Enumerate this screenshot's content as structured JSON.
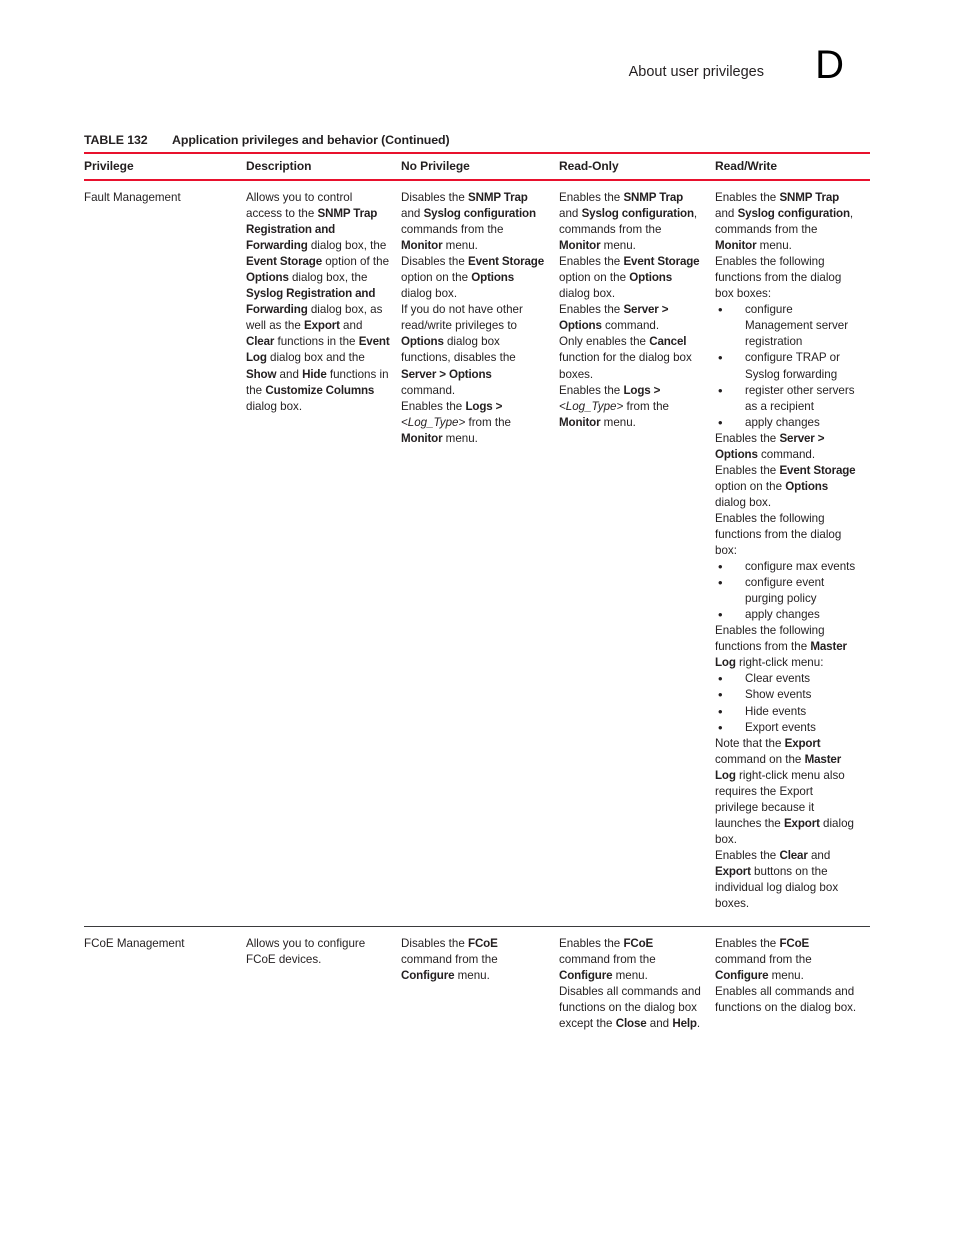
{
  "header": {
    "chapter_title": "About user privileges",
    "chapter_letter": "D"
  },
  "table": {
    "caption_number": "TABLE 132",
    "caption_text": "Application privileges and behavior (Continued)",
    "accent_color": "#e8112d",
    "rule_color": "#3a3a3c",
    "columns": [
      "Privilege",
      "Description",
      "No Privilege",
      "Read-Only",
      "Read/Write"
    ],
    "rows": [
      {
        "privilege": "Fault Management",
        "description_html": "Allows you to control access to the <b>SNMP Trap Registration and Forwarding</b> dialog box, the <b>Event Storage</b> option of the <b>Options</b> dialog box, the <b>Syslog Registration and Forwarding</b> dialog box, as well as the <b>Export</b> and <b>Clear</b> functions in the <b>Event Log</b> dialog box and the <b>Show</b> and <b>Hide</b> functions in the <b>Customize Columns</b> dialog box.",
        "no_privilege_html": "<p>Disables the <b>SNMP Trap</b> and <b>Syslog configuration</b> commands from the <b>Monitor</b> menu.</p><p>Disables the <b>Event Storage</b> option on the <b>Options</b> dialog box.</p><p>If you do not have other read/write privileges to <b>Options</b> dialog box functions, disables the <b>Server &gt; Options</b> command.</p><p>Enables the <b>Logs &gt;</b> <i>&lt;Log_Type&gt;</i> from the <b>Monitor</b> menu.</p>",
        "read_only_html": "<p>Enables the <b>SNMP Trap</b> and <b>Syslog configuration</b>, commands from the <b>Monitor</b> menu.</p><p>Enables the <b>Event Storage</b> option on the <b>Options</b> dialog box.</p><p>Enables the <b>Server &gt; Options</b> command.</p><p>Only enables the <b>Cancel</b> function for the dialog box boxes.</p><p>Enables the <b>Logs &gt;</b> <i>&lt;Log_Type&gt;</i> from the <b>Monitor</b> menu.</p>",
        "read_write_html": "<p>Enables the <b>SNMP Trap</b> and <b>Syslog configuration</b>, commands from the <b>Monitor</b> menu.</p><p>Enables the following functions from the dialog box boxes:</p><ul class=\"blist\"><li>configure Management server registration</li><li>configure TRAP or Syslog forwarding</li><li>register other servers as a recipient</li><li>apply changes</li></ul><p>Enables the <b>Server &gt; Options</b> command.</p><p>Enables the <b>Event Storage</b> option on the <b>Options</b> dialog box.</p><p>Enables the following functions from the dialog box:</p><ul class=\"blist\"><li>configure max events</li><li>configure event purging policy</li><li>apply changes</li></ul><p>Enables the following functions from the <b>Master Log</b> right-click menu:</p><ul class=\"blist\"><li>Clear events</li><li>Show events</li><li>Hide events</li><li>Export events</li></ul><p>Note that the <b>Export</b> command on the <b>Master Log</b> right-click menu also requires the Export privilege because it launches the <b>Export</b> dialog box.</p><p>Enables the <b>Clear</b> and <b>Export</b> buttons on the individual log dialog box boxes.</p>"
      },
      {
        "privilege": "FCoE Management",
        "description_html": "Allows you to configure FCoE devices.",
        "no_privilege_html": "<p>Disables the <b>FCoE</b> command from the <b>Configure</b> menu.</p>",
        "read_only_html": "<p>Enables the <b>FCoE</b> command from the <b>Configure</b> menu.</p><p>Disables all commands and functions on the dialog box except the <b>Close</b> and <b>Help</b>.</p>",
        "read_write_html": "<p>Enables the <b>FCoE</b> command from the <b>Configure</b> menu.</p><p>Enables all commands and functions on the dialog box.</p>"
      }
    ]
  }
}
